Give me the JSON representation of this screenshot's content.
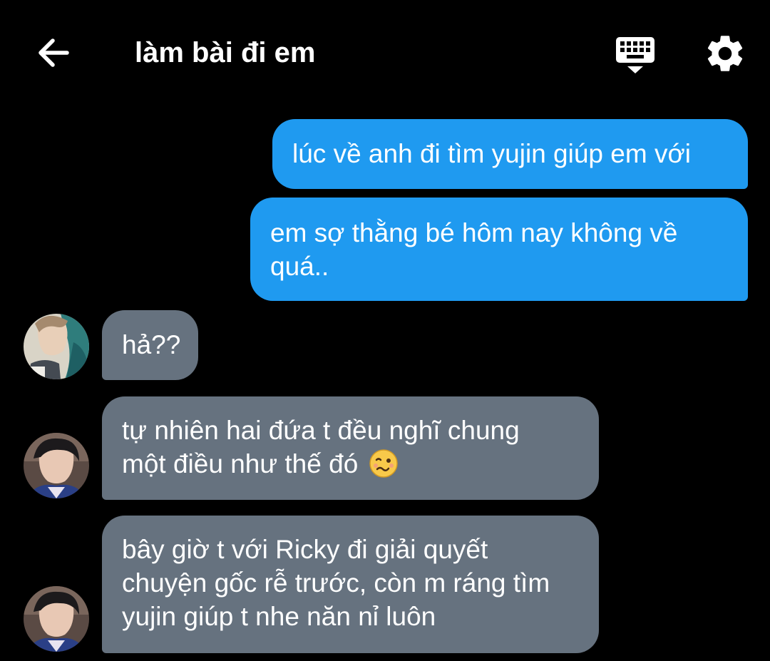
{
  "header": {
    "title": "làm bài đi em",
    "back_icon": "arrow-left-icon",
    "keyboard_icon": "keyboard-hide-icon",
    "settings_icon": "gear-icon"
  },
  "colors": {
    "background": "#000000",
    "outgoing_bubble": "#1f9af0",
    "incoming_bubble": "#66727f",
    "text": "#ffffff"
  },
  "messages": [
    {
      "direction": "outgoing",
      "lines": [
        "lúc về anh đi tìm yujin giúp em với"
      ]
    },
    {
      "direction": "outgoing",
      "lines": [
        "em sợ thằng bé hôm nay không về",
        "quá.."
      ]
    },
    {
      "direction": "incoming",
      "lines": [
        "hả??"
      ]
    },
    {
      "direction": "incoming",
      "lines": [
        "tự nhiên hai đứa t đều nghĩ chung",
        "một điều như thế đó"
      ],
      "emoji": "woozy-face-icon"
    },
    {
      "direction": "incoming",
      "lines": [
        "bây giờ t với Ricky đi giải quyết",
        "chuyện gốc rễ trước, còn m ráng tìm",
        "yujin giúp t nhe năn nỉ luôn"
      ]
    }
  ]
}
